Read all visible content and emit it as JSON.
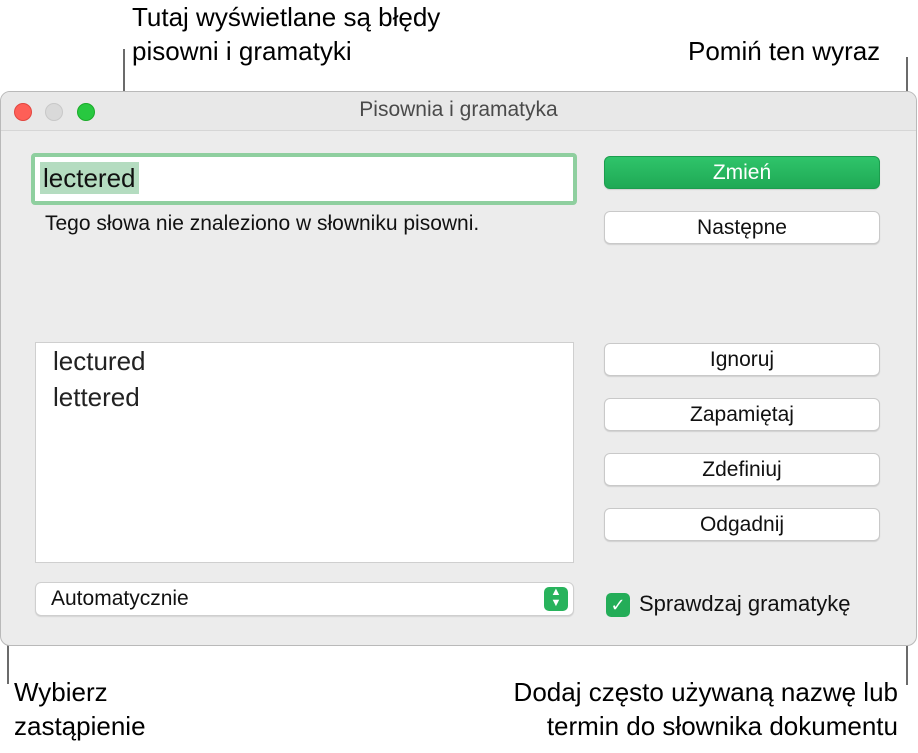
{
  "callouts": {
    "errors_line1": "Tutaj wyświetlane są błędy",
    "errors_line2": "pisowni i gramatyki",
    "ignore": "Pomiń ten wyraz",
    "choose_line1": "Wybierz",
    "choose_line2": "zastąpienie",
    "learn_line1": "Dodaj często używaną nazwę lub",
    "learn_line2": "termin do słownika dokumentu"
  },
  "window": {
    "title": "Pisownia i gramatyka"
  },
  "word_field": {
    "value": "lectered"
  },
  "message": "Tego słowa nie znaleziono w słowniku pisowni.",
  "buttons": {
    "change": "Zmień",
    "next": "Następne",
    "ignore": "Ignoruj",
    "learn": "Zapamiętaj",
    "define": "Zdefiniuj",
    "guess": "Odgadnij"
  },
  "suggestions": [
    "lectured",
    "lettered"
  ],
  "language_select": {
    "value": "Automatycznie"
  },
  "grammar_checkbox": {
    "label": "Sprawdzaj gramatykę",
    "checked": true
  },
  "colors": {
    "accent_green": "#28b35c",
    "close_red": "#fe5f57",
    "zoom_green": "#28c840"
  }
}
